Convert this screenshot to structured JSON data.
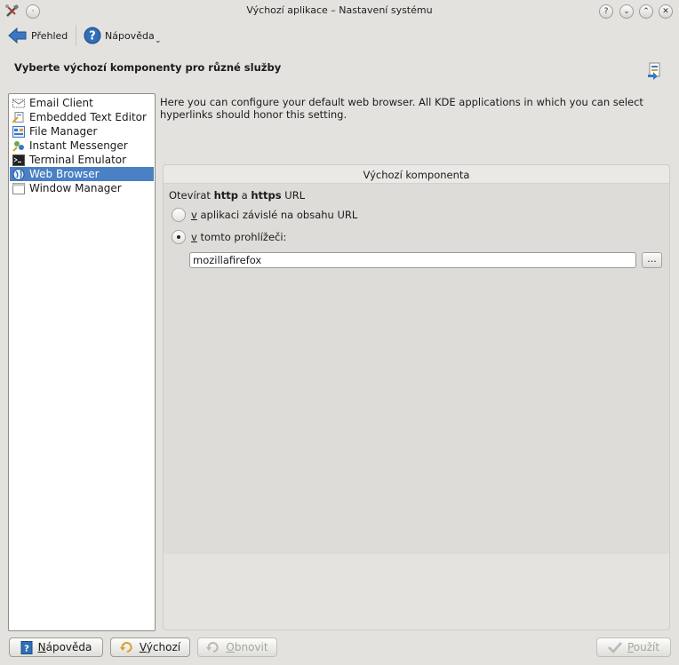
{
  "window": {
    "title": "Výchozí aplikace – Nastavení systému",
    "controls": {
      "help": "?",
      "minimize": "⌄",
      "maximize": "⌃",
      "close": "✕"
    }
  },
  "toolbar": {
    "back_label": "Přehled",
    "help_label": "Nápověda"
  },
  "header": {
    "title": "Vyberte výchozí komponenty pro různé služby"
  },
  "sidebar": {
    "items": [
      {
        "label": "Email Client",
        "icon": "email-icon"
      },
      {
        "label": "Embedded Text Editor",
        "icon": "text-editor-icon"
      },
      {
        "label": "File Manager",
        "icon": "file-manager-icon"
      },
      {
        "label": "Instant Messenger",
        "icon": "messenger-icon"
      },
      {
        "label": "Terminal Emulator",
        "icon": "terminal-icon"
      },
      {
        "label": "Web Browser",
        "icon": "globe-icon",
        "selected": true
      },
      {
        "label": "Window Manager",
        "icon": "window-icon"
      }
    ]
  },
  "main": {
    "description": "Here you can configure your default web browser. All KDE applications in which you can select hyperlinks should honor this setting.",
    "group_title": "Výchozí komponenta",
    "open_label": {
      "prefix": "Otevírat ",
      "http": "http",
      "middle": " a ",
      "https": "https",
      "suffix": " URL"
    },
    "radio_content": {
      "accel": "v",
      "rest": " aplikaci závislé na obsahu URL",
      "checked": false
    },
    "radio_browser": {
      "accel": "v",
      "rest": " tomto prohlížeči:",
      "checked": true
    },
    "browser_value": "mozillafirefox",
    "browse_label": "..."
  },
  "buttons": {
    "help": {
      "accel": "N",
      "rest": "ápověda"
    },
    "defaults": {
      "accel": "V",
      "rest": "ýchozí"
    },
    "reset": {
      "accel": "O",
      "rest": "bnovit"
    },
    "apply": {
      "accel": "P",
      "rest": "oužít"
    }
  },
  "colors": {
    "selection": "#4a81c4",
    "accent": "#2f6fb7"
  }
}
